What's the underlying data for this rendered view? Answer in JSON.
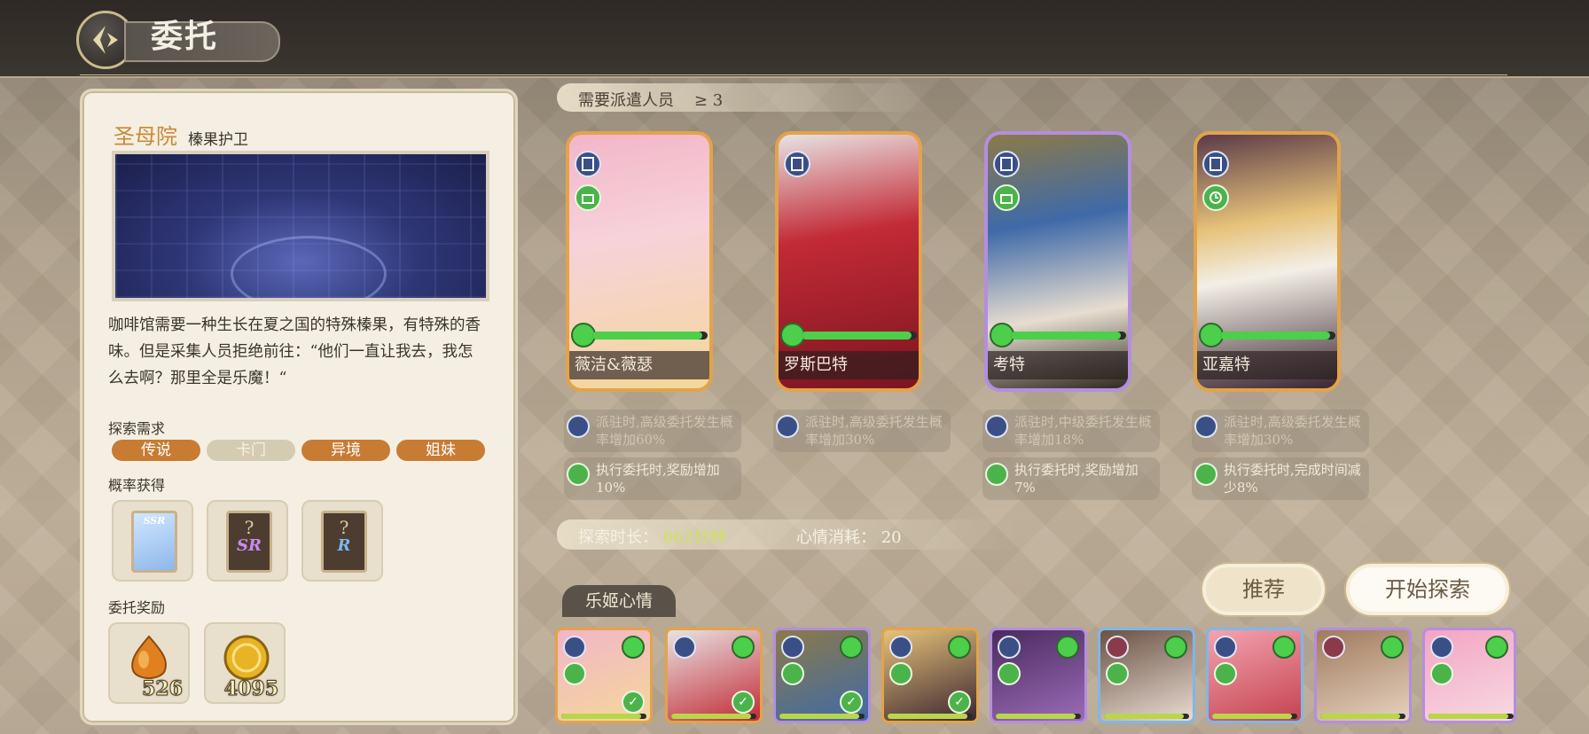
{
  "header": {
    "title": "委托"
  },
  "commission": {
    "location": "圣母院",
    "subtitle": "榛果护卫",
    "description": "咖啡馆需要一种生长在夏之国的特殊榛果，有特殊的香味。但是采集人员拒绝前往：“他们一直让我去，我怎么去啊？那里全是乐魔！“",
    "explore_label": "探索需求",
    "tags": [
      {
        "label": "传说",
        "met": true
      },
      {
        "label": "卡门",
        "met": false
      },
      {
        "label": "异境",
        "met": true
      },
      {
        "label": "姐妹",
        "met": true
      }
    ],
    "drops_label": "概率获得",
    "drops": [
      {
        "rank": "SSR",
        "icon": "character-card-icon"
      },
      {
        "rank": "SR",
        "icon": "mystery-card-icon"
      },
      {
        "rank": "R",
        "icon": "mystery-card-icon"
      }
    ],
    "rewards_label": "委托奖励",
    "rewards": [
      {
        "amount": "526",
        "icon": "amber-gem-icon"
      },
      {
        "amount": "4095",
        "icon": "gold-coin-icon"
      }
    ]
  },
  "dispatch": {
    "required_label": "需要派遣人员",
    "required_value": "≥ 3",
    "characters": [
      {
        "name": "薇洁&薇瑟",
        "mood": 0.95,
        "frame": "gold",
        "colors": [
          "#f2b6c8",
          "#f4d79a"
        ]
      },
      {
        "name": "罗斯巴特",
        "mood": 0.95,
        "frame": "gold",
        "colors": [
          "#b41f2d",
          "#e8e3e3"
        ]
      },
      {
        "name": "考特",
        "mood": 0.95,
        "frame": "purple",
        "colors": [
          "#3f6aa8",
          "#8c7a48"
        ]
      },
      {
        "name": "亚嘉特",
        "mood": 0.95,
        "frame": "gold",
        "colors": [
          "#3b2530",
          "#e6c27a"
        ]
      }
    ],
    "bonuses": [
      {
        "line1": "派驻时,高级委托发生概率增加60%",
        "line2": "执行委托时,奖励增加10%"
      },
      {
        "line1": "派驻时,高级委托发生概率增加30%",
        "line2": ""
      },
      {
        "line1": "派驻时,中级委托发生概率增加18%",
        "line2": "执行委托时,奖励增加7%"
      },
      {
        "line1": "派驻时,高级委托发生概率增加30%",
        "line2": "执行委托时,完成时间减少8%"
      }
    ],
    "duration_label": "探索时长：",
    "duration_value": "662分钟",
    "mood_cost_label": "心情消耗：",
    "mood_cost_value": "20",
    "recommend_label": "推荐",
    "start_label": "开始探索"
  },
  "roster": {
    "tab_label": "乐姬心情",
    "colors": {
      "accent_gold": "#e3a34a",
      "accent_purple": "#b48ee0",
      "mood_green": "#4ccf4a"
    }
  }
}
